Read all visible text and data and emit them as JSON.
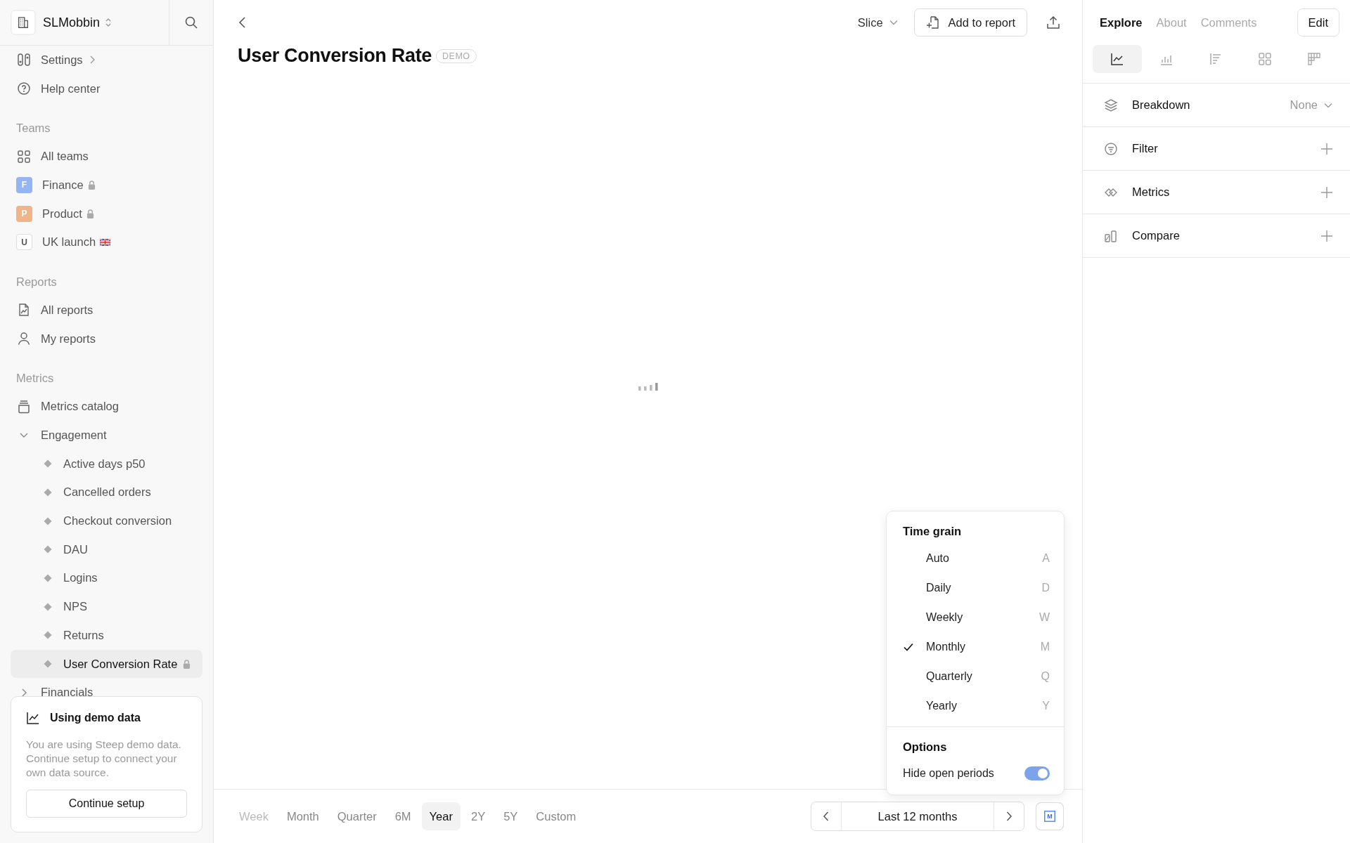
{
  "workspace": {
    "name": "SLMobbin"
  },
  "sidebar": {
    "top_items": [
      {
        "label": "Settings",
        "kind": "settings",
        "selected": false
      },
      {
        "label": "Help center",
        "kind": "help",
        "selected": false
      }
    ],
    "sections": [
      {
        "title": "Teams",
        "items": [
          {
            "label": "All teams",
            "kind": "grid",
            "selected": false
          },
          {
            "label": "Finance",
            "kind": "avatar",
            "badge": "F",
            "color": "#94b4f2",
            "locked": true,
            "selected": false
          },
          {
            "label": "Product",
            "kind": "avatar",
            "badge": "P",
            "color": "#f0b48a",
            "locked": true,
            "selected": false
          },
          {
            "label": "UK launch",
            "kind": "avatar",
            "badge": "U",
            "color": "#ffffff",
            "locked": false,
            "flag": true,
            "selected": false
          }
        ]
      },
      {
        "title": "Reports",
        "items": [
          {
            "label": "All reports",
            "kind": "report",
            "selected": false
          },
          {
            "label": "My reports",
            "kind": "person",
            "selected": false
          }
        ]
      },
      {
        "title": "Metrics",
        "items": [
          {
            "label": "Metrics catalog",
            "kind": "catalog",
            "selected": false
          },
          {
            "label": "Engagement",
            "kind": "folder",
            "expanded": true,
            "selected": false,
            "children": [
              {
                "label": "Active days p50",
                "locked": false,
                "selected": false
              },
              {
                "label": "Cancelled orders",
                "locked": false,
                "selected": false
              },
              {
                "label": "Checkout conversion",
                "locked": false,
                "selected": false
              },
              {
                "label": "DAU",
                "locked": false,
                "selected": false
              },
              {
                "label": "Logins",
                "locked": false,
                "selected": false
              },
              {
                "label": "NPS",
                "locked": false,
                "selected": false
              },
              {
                "label": "Returns",
                "locked": false,
                "selected": false
              },
              {
                "label": "User Conversion Rate",
                "locked": true,
                "selected": true
              }
            ]
          },
          {
            "label": "Financials",
            "kind": "folder",
            "expanded": false,
            "selected": false
          }
        ]
      }
    ],
    "demo_card": {
      "title": "Using demo data",
      "text": "You are using Steep demo data. Continue setup to connect your own data source.",
      "button": "Continue setup"
    }
  },
  "header": {
    "title": "User Conversion Rate",
    "badge": "DEMO",
    "slice": "Slice",
    "add_button": "Add to report"
  },
  "right_panel": {
    "tabs": [
      {
        "label": "Explore",
        "selected": true
      },
      {
        "label": "About",
        "selected": false
      },
      {
        "label": "Comments",
        "selected": false
      }
    ],
    "edit_button": "Edit",
    "chart_types": [
      {
        "kind": "line",
        "selected": true
      },
      {
        "kind": "bar",
        "selected": false
      },
      {
        "kind": "rows",
        "selected": false
      },
      {
        "kind": "grid",
        "selected": false
      },
      {
        "kind": "table",
        "selected": false
      }
    ],
    "sections": [
      {
        "label": "Breakdown",
        "kind": "breakdown",
        "value": "None"
      },
      {
        "label": "Filter",
        "kind": "filter"
      },
      {
        "label": "Metrics",
        "kind": "metrics"
      },
      {
        "label": "Compare",
        "kind": "compare"
      }
    ]
  },
  "time_grain_menu": {
    "title": "Time grain",
    "options": [
      {
        "label": "Auto",
        "shortcut": "A",
        "selected": false
      },
      {
        "label": "Daily",
        "shortcut": "D",
        "selected": false
      },
      {
        "label": "Weekly",
        "shortcut": "W",
        "selected": false
      },
      {
        "label": "Monthly",
        "shortcut": "M",
        "selected": true
      },
      {
        "label": "Quarterly",
        "shortcut": "Q",
        "selected": false
      },
      {
        "label": "Yearly",
        "shortcut": "Y",
        "selected": false
      }
    ],
    "options_title": "Options",
    "toggle": {
      "label": "Hide open periods",
      "on": true
    }
  },
  "bottom_bar": {
    "ranges": [
      {
        "label": "Week",
        "selected": false,
        "disabled": true
      },
      {
        "label": "Month",
        "selected": false,
        "disabled": false
      },
      {
        "label": "Quarter",
        "selected": false,
        "disabled": false
      },
      {
        "label": "6M",
        "selected": false,
        "disabled": false
      },
      {
        "label": "Year",
        "selected": true,
        "disabled": false
      },
      {
        "label": "2Y",
        "selected": false,
        "disabled": false
      },
      {
        "label": "5Y",
        "selected": false,
        "disabled": false
      },
      {
        "label": "Custom",
        "selected": false,
        "disabled": false
      }
    ],
    "period": "Last 12 months",
    "grain_button": "M"
  }
}
